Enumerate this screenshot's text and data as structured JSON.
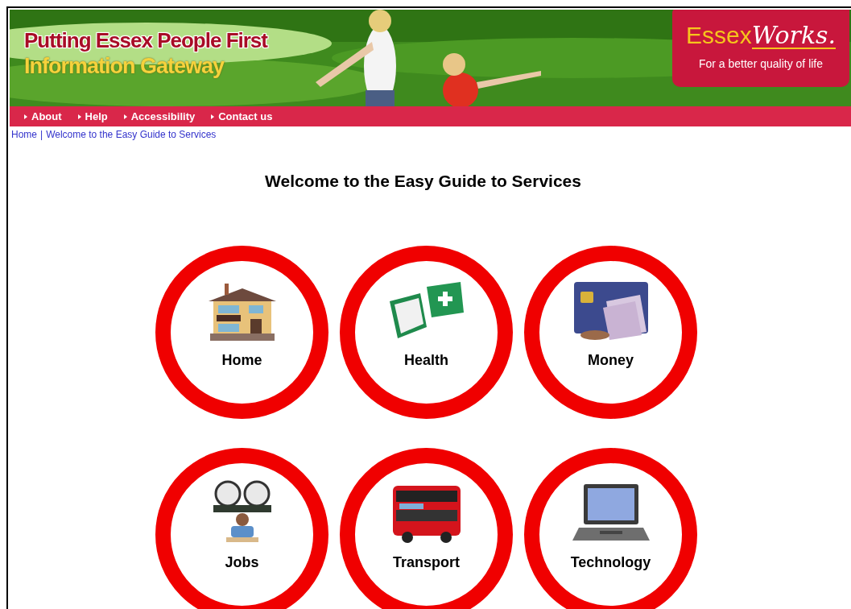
{
  "banner": {
    "headline": "Putting Essex People First",
    "subheadline": "Information Gateway",
    "logo": {
      "word": "Essex",
      "script": "Works.",
      "tagline": "For a better quality of life"
    }
  },
  "nav": [
    {
      "label": "About"
    },
    {
      "label": "Help"
    },
    {
      "label": "Accessibility"
    },
    {
      "label": "Contact us"
    }
  ],
  "breadcrumb": {
    "home": "Home",
    "separator": "|",
    "current": "Welcome to the Easy Guide to Services"
  },
  "title": "Welcome to the Easy Guide to Services",
  "services": [
    {
      "label": "Home"
    },
    {
      "label": "Health"
    },
    {
      "label": "Money"
    },
    {
      "label": "Jobs"
    },
    {
      "label": "Transport"
    },
    {
      "label": "Technology"
    }
  ]
}
